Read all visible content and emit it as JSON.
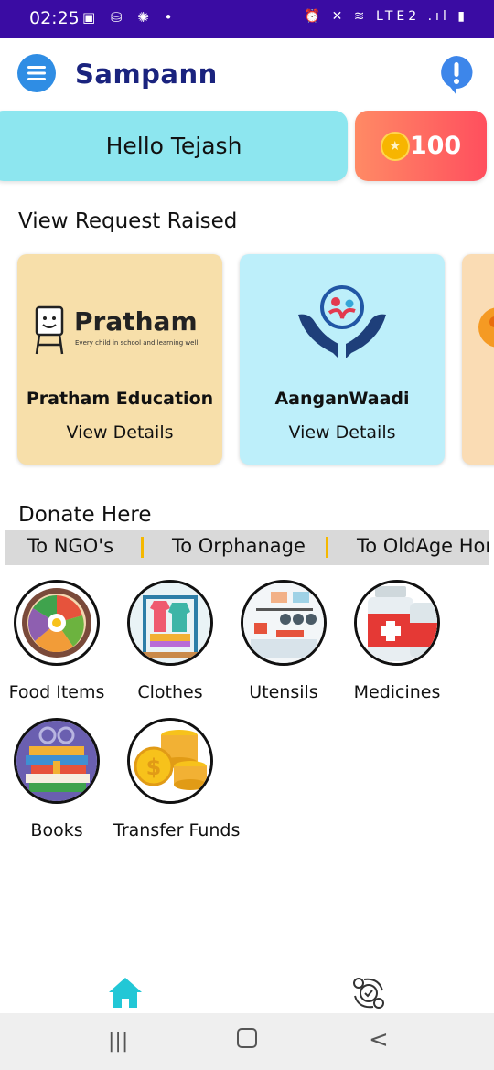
{
  "status_bar": {
    "time": "02:25",
    "left_icons": "▣ ⛁ ✺ •",
    "right_icons": "⏰ ✕ ≋ LTE2 .ıl ▮"
  },
  "header": {
    "title": "Sampann",
    "menu_icon": "hamburger-menu-icon",
    "alert_icon": "exclamation-alert-icon"
  },
  "greeting": {
    "text": "Hello Tejash"
  },
  "coins": {
    "value": "100",
    "icon": "coin-star-icon"
  },
  "requests": {
    "title": "View Request Raised",
    "cards": [
      {
        "name": "Pratham Education",
        "details_label": "View Details",
        "logo_word": "Pratham",
        "logo_tagline": "Every child in school and learning well",
        "bg": "#f7dfaa"
      },
      {
        "name": "AanganWaadi",
        "details_label": "View Details",
        "bg": "#bdeffa"
      }
    ]
  },
  "donate": {
    "title": "Donate Here",
    "tabs": [
      "To NGO's",
      "To Orphanage",
      "To OldAge Hor"
    ],
    "categories": [
      {
        "label": "Food Items"
      },
      {
        "label": "Clothes"
      },
      {
        "label": "Utensils"
      },
      {
        "label": "Medicines"
      },
      {
        "label": "Books"
      },
      {
        "label": "Transfer Funds"
      }
    ]
  },
  "bottom_nav": {
    "home_icon": "home-icon",
    "exchange_icon": "exchange-icon"
  },
  "system_nav": {
    "recents": "|||",
    "home": "○",
    "back": "<"
  },
  "colors": {
    "accent": "#2f8de4",
    "title": "#1a237e",
    "status_bar": "#3a0ca3",
    "home_active": "#22c7d6"
  }
}
